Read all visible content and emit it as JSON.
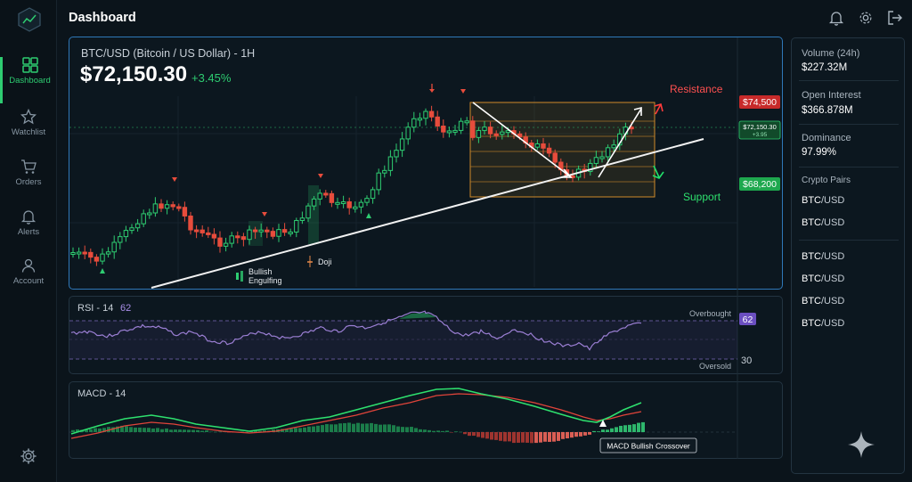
{
  "header": {
    "title": "Dashboard"
  },
  "sidebar": {
    "items": [
      {
        "label": "Dashboard",
        "icon": "dashboard-grid-icon",
        "active": true
      },
      {
        "label": "Watchlist",
        "icon": "star-icon"
      },
      {
        "label": "Orders",
        "icon": "cart-icon"
      },
      {
        "label": "Alerts",
        "icon": "bell-icon"
      },
      {
        "label": "Account",
        "icon": "user-icon"
      }
    ],
    "bottom_icon": "gear-icon"
  },
  "header_icons": [
    "bell-icon",
    "gear-icon",
    "logout-icon"
  ],
  "main_chart": {
    "pair_title": "BTC/USD (Bitcoin / US Dollar) - 1H",
    "price": "$72,150.30",
    "change": "+3.45%",
    "resistance_label": "Resistance",
    "resistance_price": "$74,500",
    "support_label": "Support",
    "support_price": "$68,200",
    "current_price_tag": "$72,150.30",
    "current_change_tag": "+3.95",
    "annotation_bullish": "Bullish",
    "annotation_engulfing": "Engulfing",
    "annotation_doji": "Doji"
  },
  "rsi": {
    "title": "RSI - 14",
    "value": "62",
    "overbought_label": "Overbought",
    "oversold_label": "Oversold",
    "oversold_value": "30"
  },
  "macd": {
    "title": "MACD - 14",
    "crossover_label": "MACD Bullish Crossover"
  },
  "right_panel": {
    "volume_label": "Volume (24h)",
    "volume_value": "$227.32M",
    "oi_label": "Open Interest",
    "oi_value": "$366.878M",
    "dominance_label": "Dominance",
    "dominance_value": "97.99%",
    "pairs_label": "Crypto Pairs",
    "pairs": [
      {
        "base": "BTC",
        "quote": "/USD"
      },
      {
        "base": "BTC",
        "quote": "/USD"
      },
      {
        "base": "BTC",
        "quote": "/USD"
      },
      {
        "base": "BTC",
        "quote": "/USD"
      },
      {
        "base": "BTC",
        "quote": "/USD"
      }
    ]
  },
  "colors": {
    "accent": "#2ecc71",
    "bear": "#e74c3c",
    "resistance": "#ff3b3b",
    "support": "#22e06a",
    "rsi": "#9b7fd4",
    "highlight_border": "#2f78b8"
  }
}
